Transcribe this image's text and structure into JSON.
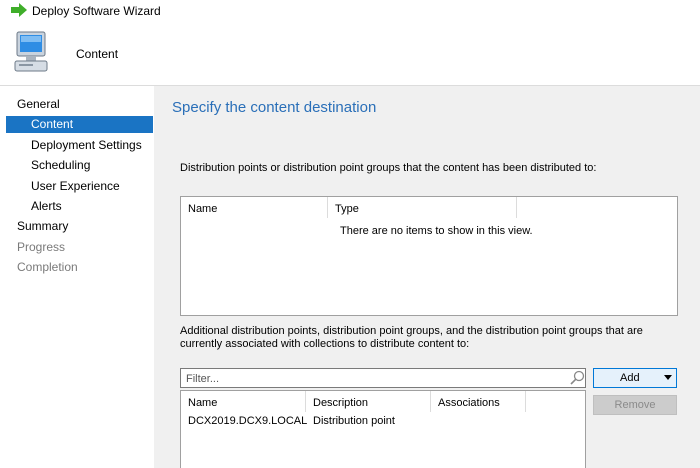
{
  "window": {
    "title": "Deploy Software Wizard"
  },
  "header": {
    "title": "Content"
  },
  "nav": {
    "items": [
      {
        "label": "General",
        "state": "normal"
      },
      {
        "label": "Content",
        "state": "selected"
      },
      {
        "label": "Deployment Settings",
        "state": "normal"
      },
      {
        "label": "Scheduling",
        "state": "normal"
      },
      {
        "label": "User Experience",
        "state": "normal"
      },
      {
        "label": "Alerts",
        "state": "normal"
      },
      {
        "label": "Summary",
        "state": "normal"
      },
      {
        "label": "Progress",
        "state": "disabled"
      },
      {
        "label": "Completion",
        "state": "disabled"
      }
    ]
  },
  "main": {
    "heading": "Specify the content destination",
    "distributed_desc": "Distribution points or distribution point groups that the content has been distributed to:",
    "distributed_table": {
      "columns": [
        "Name",
        "Type"
      ],
      "empty_message": "There are no items to show in this view."
    },
    "additional_desc": "Additional distribution points, distribution point groups, and the distribution point groups that are currently associated with collections to distribute content to:",
    "filter": {
      "placeholder": "Filter...",
      "value": ""
    },
    "add_button": "Add",
    "remove_button": "Remove",
    "additional_table": {
      "columns": [
        "Name",
        "Description",
        "Associations"
      ],
      "rows": [
        {
          "name": "DCX2019.DCX9.LOCAL",
          "description": "Distribution point",
          "associations": ""
        }
      ]
    }
  },
  "colors": {
    "accent": "#1a74c4",
    "heading": "#2a6fb8",
    "panel_bg": "#f0f0f0"
  },
  "icons": {
    "title": "green-arrow-icon",
    "header": "computer-icon",
    "filter": "search-icon"
  }
}
